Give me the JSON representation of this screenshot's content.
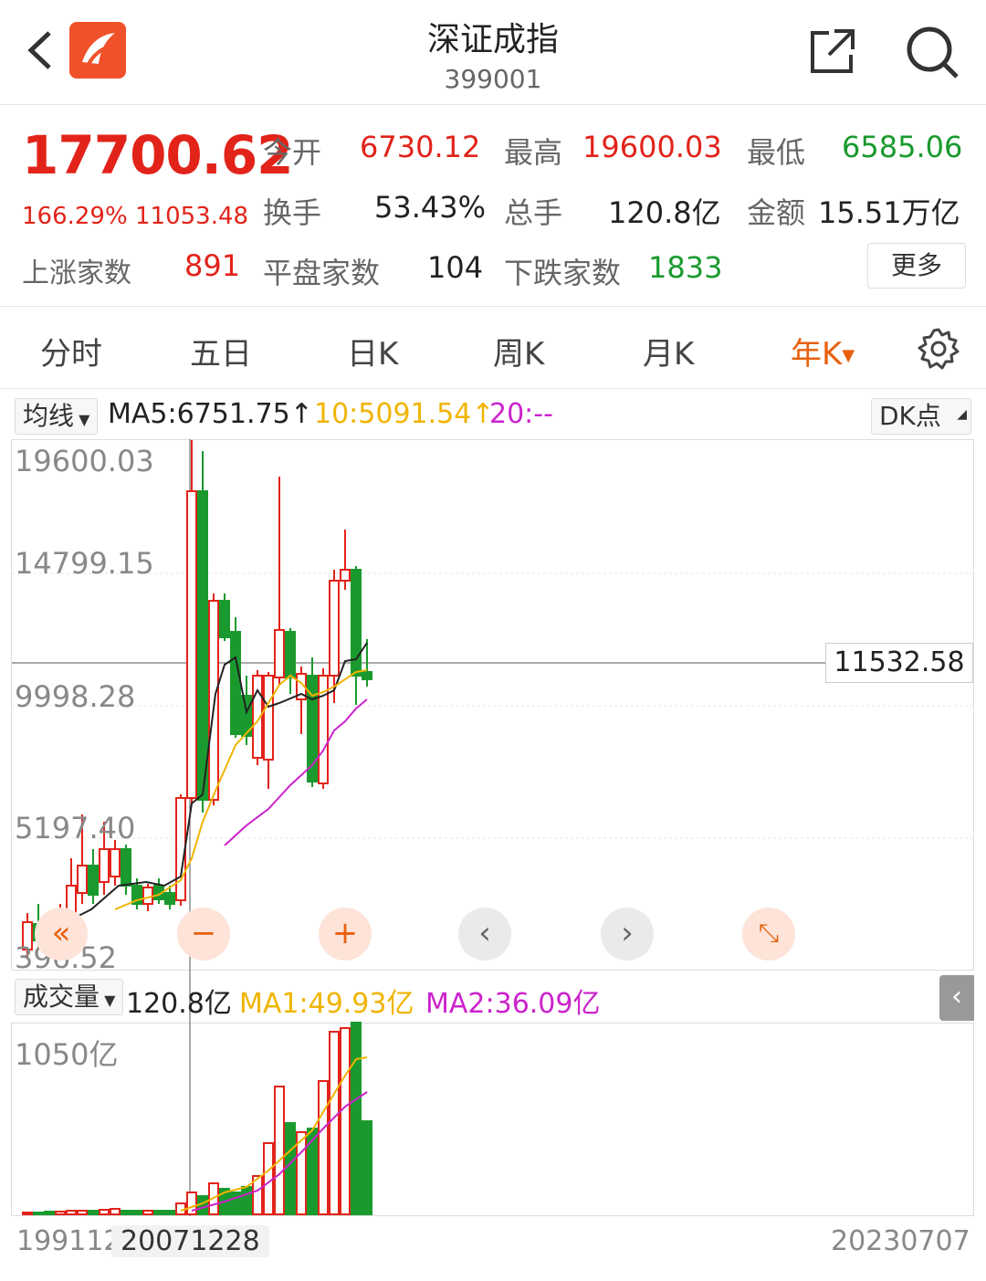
{
  "header": {
    "title": "深证成指",
    "code": "399001"
  },
  "quote": {
    "price": "17700.62",
    "change_pct": "166.29%",
    "change": "11053.48",
    "open_label": "今开",
    "open": "6730.12",
    "high_label": "最高",
    "high": "19600.03",
    "low_label": "最低",
    "low": "6585.06",
    "turnover_label": "换手",
    "turnover": "53.43%",
    "volume_label": "总手",
    "volume": "120.8亿",
    "amount_label": "金额",
    "amount": "15.51万亿",
    "up_label": "上涨家数",
    "up": "891",
    "flat_label": "平盘家数",
    "flat": "104",
    "down_label": "下跌家数",
    "down": "1833",
    "more": "更多"
  },
  "tabs": [
    "分时",
    "五日",
    "日K",
    "周K",
    "月K",
    "年K"
  ],
  "active_tab": "年K",
  "ma_row": {
    "selector": "均线",
    "ma5": "MA5:6751.75",
    "ma10": "10:5091.54",
    "ma20": "20:--",
    "dk": "DK点"
  },
  "axis": {
    "y1": "19600.03",
    "y2": "14799.15",
    "y3": "9998.28",
    "y4": "5197.40",
    "y5": "396.52",
    "crosshair_price": "11532.58"
  },
  "vol_row": {
    "selector": "成交量",
    "vol": "120.8亿",
    "ma1": "MA1:49.93亿",
    "ma2": "MA2:36.09亿",
    "ymax": "1050亿"
  },
  "dates": {
    "start": "199112",
    "cursor": "20071228",
    "end": "20230707"
  },
  "colors": {
    "up": "#e2231a",
    "down": "#1a9a2e",
    "accent": "#e8600e",
    "ma5": "#222222",
    "ma10": "#f0b400",
    "ma20": "#cc22cc"
  },
  "controls": [
    "left-double-icon",
    "minus-icon",
    "plus-icon",
    "chevron-left-icon",
    "chevron-right-icon",
    "expand-icon"
  ]
}
